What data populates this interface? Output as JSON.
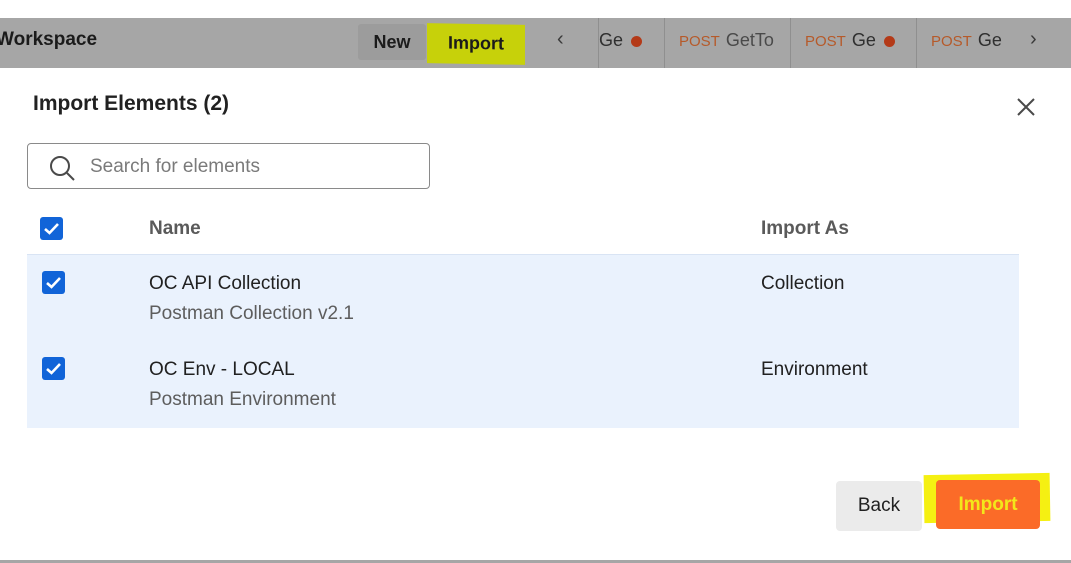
{
  "topbar": {
    "workspace": "Workspace",
    "new_label": "New",
    "import_label": "Import",
    "tabs": [
      {
        "method": "",
        "label": "Ge"
      },
      {
        "method": "POST",
        "label": "GetTo"
      },
      {
        "method": "POST",
        "label": "Ge"
      },
      {
        "method": "POST",
        "label": "Ge"
      }
    ]
  },
  "modal": {
    "title": "Import Elements (2)",
    "search_placeholder": "Search for elements",
    "columns": {
      "name": "Name",
      "import_as": "Import As"
    },
    "rows": [
      {
        "name": "OC API Collection",
        "sub": "Postman Collection v2.1",
        "import_as": "Collection"
      },
      {
        "name": "OC Env - LOCAL",
        "sub": "Postman Environment",
        "import_as": "Environment"
      }
    ],
    "back_label": "Back",
    "import_label": "Import"
  },
  "colors": {
    "checkbox": "#1164d8",
    "row_highlight": "#eaf2fd",
    "import_button": "#fb6b28",
    "marker_highlight": "#f5f012"
  }
}
